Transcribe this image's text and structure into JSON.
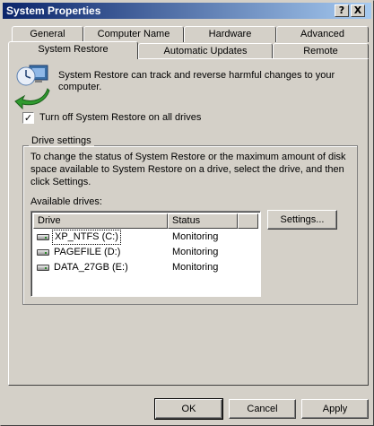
{
  "window": {
    "title": "System Properties",
    "help_button": "?",
    "close_button": "X"
  },
  "tabs": {
    "row1": [
      "General",
      "Computer Name",
      "Hardware",
      "Advanced"
    ],
    "row2": [
      "System Restore",
      "Automatic Updates",
      "Remote"
    ],
    "active": "System Restore"
  },
  "intro_text": "System Restore can track and reverse harmful changes to your computer.",
  "icon": "system-restore-icon",
  "turn_off": {
    "label": "Turn off System Restore on all drives",
    "checked": true,
    "check_glyph": "✓"
  },
  "drive_settings": {
    "group_label": "Drive settings",
    "description": "To change the status of System Restore or the maximum amount of disk space available to System Restore on a drive, select the drive, and then click Settings.",
    "available_label": "Available drives:",
    "columns": [
      "Drive",
      "Status"
    ],
    "drives": [
      {
        "name": "XP_NTFS (C:)",
        "status": "Monitoring",
        "selected": true
      },
      {
        "name": "PAGEFILE (D:)",
        "status": "Monitoring",
        "selected": false
      },
      {
        "name": "DATA_27GB (E:)",
        "status": "Monitoring",
        "selected": false
      }
    ],
    "settings_button": "Settings..."
  },
  "footer": {
    "ok": "OK",
    "cancel": "Cancel",
    "apply": "Apply"
  },
  "colors": {
    "titlebar_start": "#0a246a",
    "titlebar_end": "#a6caf0",
    "face": "#d4d0c8"
  }
}
